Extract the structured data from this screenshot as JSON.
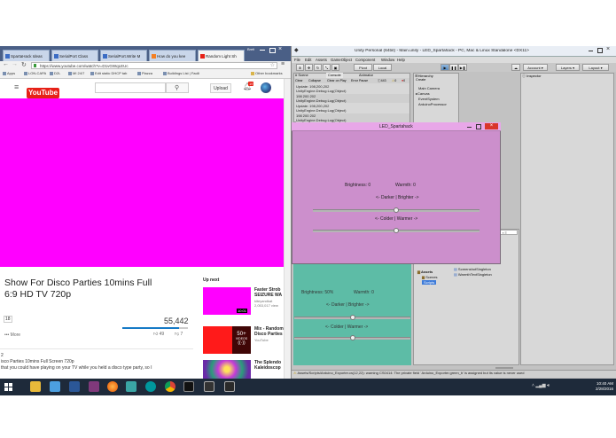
{
  "browser": {
    "profile": "Brett",
    "tabs": [
      {
        "label": "SpartaHack Ideas"
      },
      {
        "label": "SerialPort Class"
      },
      {
        "label": "SerialPort.Write M"
      },
      {
        "label": "How do you kee"
      },
      {
        "label": "Random Light Sh"
      }
    ],
    "url": "https://www.youtube.com/watch?v=D1vGWqLEUc",
    "bookmarks": [
      "Apps",
      "LON-CAPA",
      "D2L",
      "MI 24/7",
      "Edit static DHCP tab",
      "Piazza",
      "Buildings List | Facili"
    ],
    "other_bookmarks": "Other bookmarks"
  },
  "youtube": {
    "logo": "YouTube",
    "upload_label": "Upload",
    "notif_count": "19",
    "video_title_line1": "Show For Disco Parties 10mins Full",
    "video_title_line2": "6:9 HD TV 720p",
    "sub_count": "18",
    "view_count": "55,442",
    "more_label": "More",
    "like_count": "49",
    "dislike_count": "7",
    "upnext_label": "Up next",
    "desc_line0": "2",
    "desc_line1": "isco Parties 10mins Full Screen 720p",
    "desc_line2": "that you could have playing on your TV while you held a disco type party, so I",
    "related": [
      {
        "title1": "Faster Strob",
        "title2": "SEIZURE WA",
        "channel": "kiteyandkat",
        "views": "2,053,017 view",
        "duration": "10:01"
      },
      {
        "title1": "Mix - Random",
        "title2": "Disco Parties",
        "channel": "YouTube",
        "badge_top": "50+",
        "badge_bottom": "VIDEOS"
      },
      {
        "title1": "The Splendo",
        "title2": "Kaleidoscop"
      }
    ]
  },
  "unity": {
    "title": "Unity Personal (64bit) - Main.unity - LED_Spartahack - PC, Mac & Linux Standalone <DX11>",
    "menus": [
      "File",
      "Edit",
      "Assets",
      "GameObject",
      "Component",
      "Window",
      "Help"
    ],
    "toolbar": {
      "pivot": "Pivot",
      "local": "Local",
      "account": "Account",
      "layers": "Layers",
      "layout": "Layout"
    },
    "tabs": {
      "scene": "Scene",
      "console": "Console",
      "animator": "Animator",
      "hierarchy": "Hierarchy",
      "inspector": "Inspector",
      "project": "Project"
    },
    "console_toolbar": {
      "clear": "Clear",
      "collapse": "Collapse",
      "clear_on_play": "Clear on Play",
      "error_pause": "Error Pause",
      "count": "443",
      "warn": "0",
      "err": "0"
    },
    "logs": [
      {
        "l1": "Update: 198,200,202",
        "l2": "UnityEngine.Debug:Log(Object)"
      },
      {
        "l1": "198 200 202",
        "l2": "UnityEngine.Debug:Log(Object)"
      },
      {
        "l1": "Update: 198,200,202",
        "l2": "UnityEngine.Debug:Log(Object)"
      },
      {
        "l1": "198 200 202",
        "l2": "UnityEngine.Debug:Log(Object)"
      }
    ],
    "hierarchy_create": "Create",
    "hierarchy": [
      "Main Camera",
      "Canvas",
      "EventSystem",
      "ArduinoProcessor"
    ],
    "project_items": [
      "Assets",
      "Scenes",
      "Scripts"
    ],
    "project_assets": [
      "ScreenshotSingleton",
      "WarmthTextSingleton"
    ],
    "status": "Assets/Scripts/Arduino_Exporter.cs(12,22): warning CS0414: The private field `Arduino_Exporter.green_b' is assigned but its value is never used"
  },
  "game_window": {
    "title": "LED_Spartahack",
    "brightness": "Brightness: 0",
    "warmth": "Warmth: 0",
    "darker_brighter": "<- Darker | Brighter ->",
    "colder_warmer": "<- Colder | Warmer ->",
    "slider1": 0.5,
    "slider2": 0.5
  },
  "game_view": {
    "brightness": "Brightness: 50%",
    "warmth": "Warmth: 0",
    "darker_brighter": "<- Darker | Brighter ->",
    "colder_warmer": "<- Colder | Warmer ->",
    "slider1": 0.5,
    "slider2": 0.5
  },
  "taskbar": {
    "time": "10:40 AM",
    "date": "2/28/2016"
  },
  "colors": {
    "magenta": "#ff00ff",
    "game_window_bg": "#cc8fcc",
    "game_view_bg": "#5dbca6",
    "youtube_red": "#e62117",
    "taskbar": "#1e2a3a"
  }
}
